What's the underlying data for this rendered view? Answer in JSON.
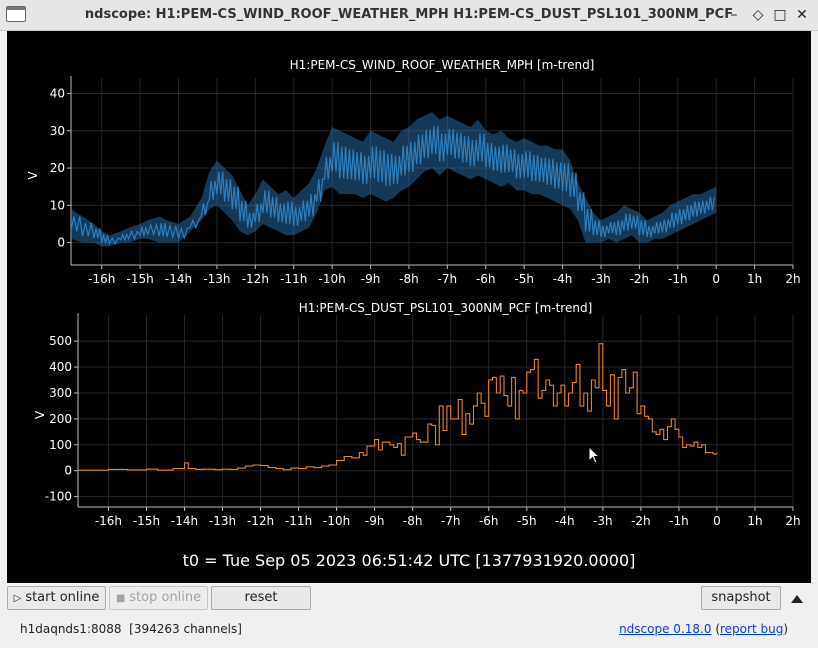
{
  "window": {
    "title": "ndscope: H1:PEM-CS_WIND_ROOF_WEATHER_MPH H1:PEM-CS_DUST_PSL101_300NM_PCF",
    "controls": [
      "–",
      "◇",
      "□",
      "✕"
    ]
  },
  "plots": [
    {
      "title": "H1:PEM-CS_WIND_ROOF_WEATHER_MPH [m-trend]",
      "ylabel": "V",
      "yticks": [
        "40",
        "30",
        "20",
        "10",
        "0"
      ],
      "xticks": [
        "-16h",
        "-15h",
        "-14h",
        "-13h",
        "-12h",
        "-11h",
        "-10h",
        "-9h",
        "-8h",
        "-7h",
        "-6h",
        "-5h",
        "-4h",
        "-3h",
        "-2h",
        "-1h",
        "0",
        "1h",
        "2h"
      ],
      "color": "#2d7fc0"
    },
    {
      "title": "H1:PEM-CS_DUST_PSL101_300NM_PCF [m-trend]",
      "ylabel": "V",
      "yticks": [
        "500",
        "400",
        "300",
        "200",
        "100",
        "0",
        "-100"
      ],
      "xticks": [
        "-16h",
        "-15h",
        "-14h",
        "-13h",
        "-12h",
        "-11h",
        "-10h",
        "-9h",
        "-8h",
        "-7h",
        "-6h",
        "-5h",
        "-4h",
        "-3h",
        "-2h",
        "-1h",
        "0",
        "1h",
        "2h"
      ],
      "color": "#e8832a"
    }
  ],
  "chart_data": [
    {
      "type": "area",
      "title": "H1:PEM-CS_WIND_ROOF_WEATHER_MPH [m-trend]",
      "ylabel": "V",
      "xlim": [
        -16.8,
        2.0
      ],
      "ylim": [
        -6,
        42
      ],
      "grid": true,
      "x_unit": "hours",
      "series": [
        {
          "x": [
            -16.8,
            -16.5,
            -16.2,
            -16.0,
            -15.8,
            -15.5,
            -15.3,
            -15.0,
            -14.8,
            -14.5,
            -14.3,
            -14.0,
            -13.7,
            -13.4,
            -13.2,
            -13.0,
            -12.8,
            -12.6,
            -12.4,
            -12.2,
            -12.0,
            -11.8,
            -11.6,
            -11.4,
            -11.2,
            -11.0,
            -10.8,
            -10.6,
            -10.4,
            -10.2,
            -10.0,
            -9.8,
            -9.6,
            -9.4,
            -9.2,
            -9.0,
            -8.8,
            -8.6,
            -8.4,
            -8.2,
            -8.0,
            -7.8,
            -7.6,
            -7.4,
            -7.2,
            -7.0,
            -6.8,
            -6.6,
            -6.4,
            -6.2,
            -6.0,
            -5.8,
            -5.6,
            -5.4,
            -5.2,
            -5.0,
            -4.8,
            -4.6,
            -4.4,
            -4.2,
            -4.0,
            -3.8,
            -3.6,
            -3.4,
            -3.2,
            -3.0,
            -2.8,
            -2.6,
            -2.4,
            -2.2,
            -2.0,
            -1.8,
            -1.6,
            -1.4,
            -1.2,
            -1.0,
            -0.8,
            -0.6,
            -0.4,
            -0.2,
            0.0
          ],
          "min": [
            1,
            0,
            0,
            -1,
            -1,
            0,
            0,
            1,
            1,
            0,
            0,
            0,
            3,
            6,
            9,
            10,
            8,
            6,
            3,
            2,
            3,
            5,
            4,
            3,
            2,
            2,
            3,
            4,
            8,
            14,
            15,
            13,
            13,
            13,
            12,
            13,
            12,
            11,
            12,
            14,
            15,
            17,
            19,
            20,
            18,
            20,
            19,
            18,
            17,
            18,
            17,
            16,
            15,
            16,
            14,
            14,
            13,
            13,
            12,
            11,
            10,
            9,
            6,
            0,
            0,
            0,
            1,
            0,
            1,
            2,
            0,
            0,
            1,
            1,
            2,
            3,
            4,
            5,
            6,
            7,
            8
          ],
          "max": [
            9,
            7,
            5,
            3,
            2,
            3,
            4,
            5,
            6,
            7,
            6,
            5,
            7,
            12,
            19,
            22,
            20,
            18,
            14,
            10,
            13,
            17,
            15,
            13,
            14,
            12,
            14,
            16,
            20,
            26,
            31,
            30,
            29,
            28,
            27,
            30,
            29,
            28,
            27,
            30,
            31,
            33,
            34,
            35,
            33,
            34,
            33,
            32,
            31,
            33,
            30,
            29,
            30,
            28,
            27,
            28,
            27,
            26,
            26,
            25,
            25,
            22,
            16,
            12,
            8,
            6,
            7,
            8,
            10,
            9,
            8,
            6,
            7,
            8,
            10,
            11,
            12,
            13,
            13,
            14,
            15
          ]
        }
      ]
    },
    {
      "type": "line",
      "title": "H1:PEM-CS_DUST_PSL101_300NM_PCF [m-trend]",
      "ylabel": "V",
      "xlim": [
        -16.8,
        2.0
      ],
      "ylim": [
        -140,
        570
      ],
      "grid": true,
      "x_unit": "hours",
      "series": [
        {
          "x": [
            -16.8,
            -16.0,
            -15.5,
            -15.0,
            -14.7,
            -14.3,
            -14.0,
            -13.9,
            -13.7,
            -13.5,
            -13.2,
            -13.0,
            -12.8,
            -12.6,
            -12.4,
            -12.2,
            -12.0,
            -11.8,
            -11.6,
            -11.4,
            -11.2,
            -11.0,
            -10.8,
            -10.6,
            -10.4,
            -10.2,
            -10.0,
            -9.8,
            -9.6,
            -9.4,
            -9.3,
            -9.2,
            -9.0,
            -8.9,
            -8.8,
            -8.6,
            -8.5,
            -8.4,
            -8.3,
            -8.2,
            -8.0,
            -7.9,
            -7.8,
            -7.6,
            -7.5,
            -7.4,
            -7.3,
            -7.2,
            -7.1,
            -7.0,
            -6.9,
            -6.8,
            -6.7,
            -6.6,
            -6.5,
            -6.4,
            -6.3,
            -6.2,
            -6.1,
            -6.0,
            -5.9,
            -5.8,
            -5.7,
            -5.6,
            -5.5,
            -5.4,
            -5.3,
            -5.2,
            -5.1,
            -5.0,
            -4.9,
            -4.8,
            -4.7,
            -4.6,
            -4.5,
            -4.4,
            -4.3,
            -4.2,
            -4.1,
            -4.0,
            -3.9,
            -3.8,
            -3.7,
            -3.6,
            -3.5,
            -3.4,
            -3.3,
            -3.2,
            -3.1,
            -3.0,
            -2.9,
            -2.8,
            -2.7,
            -2.6,
            -2.5,
            -2.4,
            -2.3,
            -2.2,
            -2.1,
            -2.0,
            -1.9,
            -1.8,
            -1.7,
            -1.6,
            -1.5,
            -1.4,
            -1.3,
            -1.2,
            -1.1,
            -1.0,
            -0.9,
            -0.8,
            -0.7,
            -0.6,
            -0.5,
            -0.4,
            -0.3,
            -0.2,
            -0.1,
            0.0
          ],
          "y": [
            2,
            5,
            3,
            6,
            2,
            8,
            30,
            8,
            5,
            6,
            4,
            6,
            5,
            10,
            18,
            22,
            20,
            12,
            8,
            4,
            10,
            8,
            15,
            12,
            18,
            22,
            40,
            55,
            50,
            70,
            60,
            95,
            120,
            80,
            110,
            100,
            90,
            105,
            60,
            130,
            145,
            120,
            110,
            180,
            175,
            100,
            250,
            155,
            250,
            200,
            200,
            275,
            140,
            220,
            180,
            250,
            300,
            260,
            210,
            350,
            360,
            300,
            365,
            290,
            250,
            360,
            200,
            310,
            300,
            380,
            390,
            430,
            280,
            310,
            350,
            330,
            250,
            300,
            330,
            250,
            300,
            340,
            410,
            250,
            300,
            230,
            350,
            320,
            490,
            310,
            250,
            370,
            200,
            360,
            390,
            300,
            320,
            380,
            220,
            250,
            210,
            200,
            150,
            140,
            160,
            120,
            170,
            200,
            160,
            130,
            90,
            100,
            95,
            110,
            90,
            100,
            70,
            70,
            65,
            70
          ]
        }
      ]
    }
  ],
  "time_label": "t0 = Tue Sep 05 2023 06:51:42 UTC [1377931920.0000]",
  "toolbar": {
    "start_online": "start online",
    "stop_online": "stop online",
    "reset": "reset",
    "snapshot": "snapshot"
  },
  "status": {
    "server": "h1daqnds1:8088",
    "channels": "[394263 channels]",
    "version_link": "ndscope 0.18.0",
    "report_bug_open": "(",
    "report_bug_link": "report bug",
    "report_bug_close": ")"
  }
}
